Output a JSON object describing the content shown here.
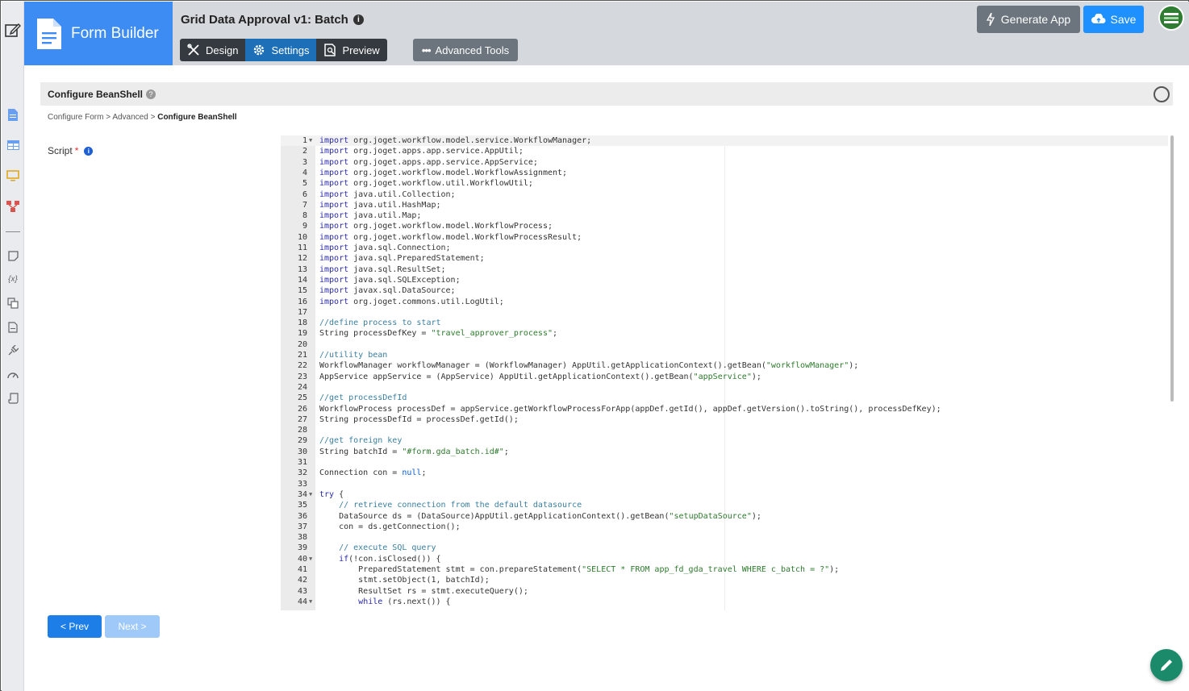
{
  "app": {
    "brand": "Form Builder",
    "title": "Grid Data Approval v1: Batch"
  },
  "tabs": [
    {
      "label": "Design"
    },
    {
      "label": "Settings"
    },
    {
      "label": "Preview"
    }
  ],
  "toolbar": {
    "advanced_tools": "Advanced Tools",
    "generate_app": "Generate App",
    "save": "Save"
  },
  "panel": {
    "heading": "Configure BeanShell"
  },
  "breadcrumb": {
    "items": [
      "Configure Form",
      "Advanced"
    ],
    "current": "Configure BeanShell",
    "separator": ">"
  },
  "field": {
    "label": "Script",
    "required_mark": "*"
  },
  "navigation": {
    "prev": "< Prev",
    "next": "Next >"
  },
  "icons": [
    "page-edit-icon",
    "document-icon",
    "table-icon",
    "monitor-icon",
    "process-icon",
    "note-icon",
    "variable-icon",
    "translate-icon",
    "file-icon",
    "plug-icon",
    "gauge-icon",
    "scroll-icon",
    "info-icon",
    "help-icon",
    "fullscreen-icon",
    "pencil-icon",
    "cloud-upload-icon",
    "bolt-icon",
    "dots-icon",
    "brush-icon",
    "gear-icon",
    "preview-icon"
  ],
  "colors": {
    "brand": "#3d8cf3",
    "primary": "#1e7ee8",
    "fab": "#1b8a6b"
  },
  "code": {
    "lines": [
      {
        "no": "1",
        "fold": true,
        "text": "import org.joget.workflow.model.service.WorkflowManager;"
      },
      {
        "no": "2",
        "text": "import org.joget.apps.app.service.AppUtil;"
      },
      {
        "no": "3",
        "text": "import org.joget.apps.app.service.AppService;"
      },
      {
        "no": "4",
        "text": "import org.joget.workflow.model.WorkflowAssignment;"
      },
      {
        "no": "5",
        "text": "import org.joget.workflow.util.WorkflowUtil;"
      },
      {
        "no": "6",
        "text": "import java.util.Collection;"
      },
      {
        "no": "7",
        "text": "import java.util.HashMap;"
      },
      {
        "no": "8",
        "text": "import java.util.Map;"
      },
      {
        "no": "9",
        "text": "import org.joget.workflow.model.WorkflowProcess;"
      },
      {
        "no": "10",
        "text": "import org.joget.workflow.model.WorkflowProcessResult;"
      },
      {
        "no": "11",
        "text": "import java.sql.Connection;"
      },
      {
        "no": "12",
        "text": "import java.sql.PreparedStatement;"
      },
      {
        "no": "13",
        "text": "import java.sql.ResultSet;"
      },
      {
        "no": "14",
        "text": "import java.sql.SQLException;"
      },
      {
        "no": "15",
        "text": "import javax.sql.DataSource;"
      },
      {
        "no": "16",
        "text": "import org.joget.commons.util.LogUtil;"
      },
      {
        "no": "17",
        "text": ""
      },
      {
        "no": "18",
        "text": "//define process to start"
      },
      {
        "no": "19",
        "text": "String processDefKey = \"travel_approver_process\";"
      },
      {
        "no": "20",
        "text": ""
      },
      {
        "no": "21",
        "text": "//utility bean"
      },
      {
        "no": "22",
        "text": "WorkflowManager workflowManager = (WorkflowManager) AppUtil.getApplicationContext().getBean(\"workflowManager\");"
      },
      {
        "no": "23",
        "text": "AppService appService = (AppService) AppUtil.getApplicationContext().getBean(\"appService\");"
      },
      {
        "no": "24",
        "text": ""
      },
      {
        "no": "25",
        "text": "//get processDefId"
      },
      {
        "no": "26",
        "text": "WorkflowProcess processDef = appService.getWorkflowProcessForApp(appDef.getId(), appDef.getVersion().toString(), processDefKey);"
      },
      {
        "no": "27",
        "text": "String processDefId = processDef.getId();"
      },
      {
        "no": "28",
        "text": ""
      },
      {
        "no": "29",
        "text": "//get foreign key"
      },
      {
        "no": "30",
        "text": "String batchId = \"#form.gda_batch.id#\";"
      },
      {
        "no": "31",
        "text": ""
      },
      {
        "no": "32",
        "text": "Connection con = null;"
      },
      {
        "no": "33",
        "text": ""
      },
      {
        "no": "34",
        "fold": true,
        "text": "try {"
      },
      {
        "no": "35",
        "text": "    // retrieve connection from the default datasource"
      },
      {
        "no": "36",
        "text": "    DataSource ds = (DataSource)AppUtil.getApplicationContext().getBean(\"setupDataSource\");"
      },
      {
        "no": "37",
        "text": "    con = ds.getConnection();"
      },
      {
        "no": "38",
        "text": ""
      },
      {
        "no": "39",
        "text": "    // execute SQL query"
      },
      {
        "no": "40",
        "fold": true,
        "text": "    if(!con.isClosed()) {"
      },
      {
        "no": "41",
        "text": "        PreparedStatement stmt = con.prepareStatement(\"SELECT * FROM app_fd_gda_travel WHERE c_batch = ?\");"
      },
      {
        "no": "42",
        "text": "        stmt.setObject(1, batchId);"
      },
      {
        "no": "43",
        "text": "        ResultSet rs = stmt.executeQuery();"
      },
      {
        "no": "44",
        "fold": true,
        "text": "        while (rs.next()) {"
      }
    ]
  }
}
